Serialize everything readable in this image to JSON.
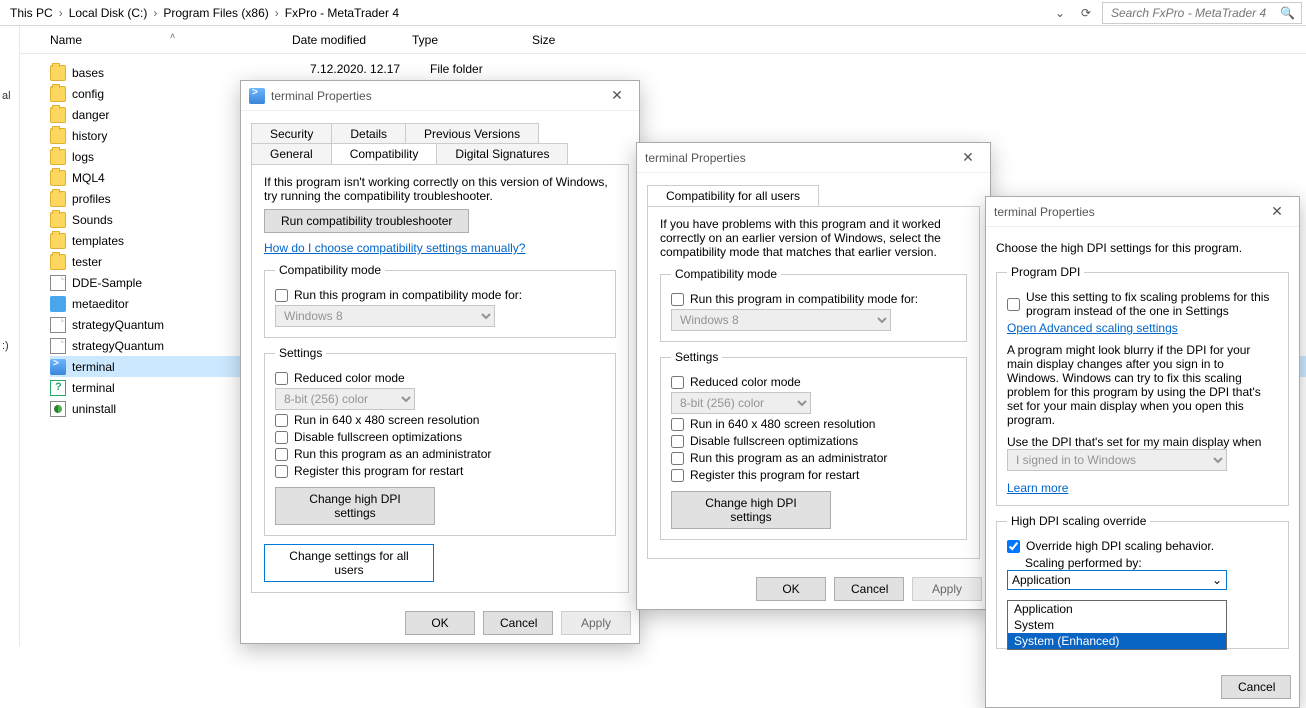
{
  "breadcrumb": [
    "This PC",
    "Local Disk (C:)",
    "Program Files (x86)",
    "FxPro - MetaTrader 4"
  ],
  "search_placeholder": "Search FxPro - MetaTrader 4",
  "columns": {
    "name": "Name",
    "date": "Date modified",
    "type": "Type",
    "size": "Size"
  },
  "left_fragments": [
    "al",
    ":)"
  ],
  "row_date": "7.12.2020. 12.17",
  "row_type": "File folder",
  "files": [
    {
      "name": "bases",
      "icon": "folder"
    },
    {
      "name": "config",
      "icon": "folder"
    },
    {
      "name": "danger",
      "icon": "folder"
    },
    {
      "name": "history",
      "icon": "folder"
    },
    {
      "name": "logs",
      "icon": "folder"
    },
    {
      "name": "MQL4",
      "icon": "folder"
    },
    {
      "name": "profiles",
      "icon": "folder"
    },
    {
      "name": "Sounds",
      "icon": "folder"
    },
    {
      "name": "templates",
      "icon": "folder"
    },
    {
      "name": "tester",
      "icon": "folder"
    },
    {
      "name": "DDE-Sample",
      "icon": "file"
    },
    {
      "name": "metaeditor",
      "icon": "app"
    },
    {
      "name": "strategyQuantum",
      "icon": "file"
    },
    {
      "name": "strategyQuantum",
      "icon": "file"
    },
    {
      "name": "terminal",
      "icon": "term",
      "sel": true
    },
    {
      "name": "terminal",
      "icon": "chm"
    },
    {
      "name": "uninstall",
      "icon": "uninst"
    }
  ],
  "dlg1": {
    "title": "terminal Properties",
    "tabs_top": [
      "Security",
      "Details",
      "Previous Versions"
    ],
    "tabs_bot": [
      "General",
      "Compatibility",
      "Digital Signatures"
    ],
    "intro": "If this program isn't working correctly on this version of Windows, try running the compatibility troubleshooter.",
    "run_troubleshooter": "Run compatibility troubleshooter",
    "help_link": "How do I choose compatibility settings manually?",
    "compat_legend": "Compatibility mode",
    "compat_chk": "Run this program in compatibility mode for:",
    "compat_sel": "Windows 8",
    "settings_legend": "Settings",
    "reduced": "Reduced color mode",
    "colorsel": "8-bit (256) color",
    "res": "Run in 640 x 480 screen resolution",
    "fullscreen": "Disable fullscreen optimizations",
    "admin": "Run this program as an administrator",
    "restart": "Register this program for restart",
    "dpi_btn": "Change high DPI settings",
    "all_users": "Change settings for all users",
    "ok": "OK",
    "cancel": "Cancel",
    "apply": "Apply"
  },
  "dlg2": {
    "title": "terminal Properties",
    "tab": "Compatibility for all users",
    "intro": "If you have problems with this program and it worked correctly on an earlier version of Windows, select the compatibility mode that matches that earlier version.",
    "compat_legend": "Compatibility mode",
    "compat_chk": "Run this program in compatibility mode for:",
    "compat_sel": "Windows 8",
    "settings_legend": "Settings",
    "reduced": "Reduced color mode",
    "colorsel": "8-bit (256) color",
    "res": "Run in 640 x 480 screen resolution",
    "fullscreen": "Disable fullscreen optimizations",
    "admin": "Run this program as an administrator",
    "restart": "Register this program for restart",
    "dpi_btn": "Change high DPI settings",
    "ok": "OK",
    "cancel": "Cancel",
    "apply": "Apply"
  },
  "dlg3": {
    "title": "terminal Properties",
    "intro": "Choose the high DPI settings for this program.",
    "group1": "Program DPI",
    "chk1": "Use this setting to fix scaling problems for this program instead of the one in Settings",
    "adv_link": "Open Advanced scaling settings",
    "para": "A program might look blurry if the DPI for your main display changes after you sign in to Windows. Windows can try to fix this scaling problem for this program by using the DPI that's set for your main display when you open this program.",
    "when_label": "Use the DPI that's set for my main display when",
    "when_sel": "I signed in to Windows",
    "learn": "Learn more",
    "group2": "High DPI scaling override",
    "chk2": "Override high DPI scaling behavior.",
    "perf": "Scaling performed by:",
    "combo": "Application",
    "options": [
      "Application",
      "System",
      "System (Enhanced)"
    ],
    "cancel": "Cancel"
  }
}
